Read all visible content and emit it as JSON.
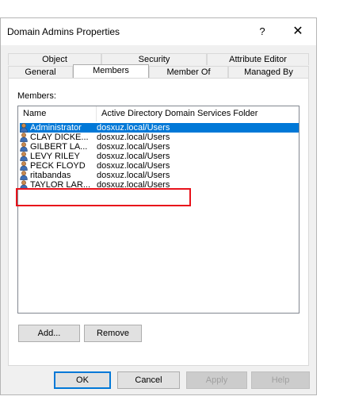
{
  "dialog": {
    "title": "Domain Admins Properties",
    "help_glyph": "?",
    "close_glyph": "✕"
  },
  "tabs": {
    "row1": [
      "Object",
      "Security",
      "Attribute Editor"
    ],
    "row2": [
      "General",
      "Members",
      "Member Of",
      "Managed By"
    ],
    "active": "Members"
  },
  "members": {
    "label": "Members:",
    "columns": [
      "Name",
      "Active Directory Domain Services Folder"
    ],
    "rows": [
      {
        "name": "Administrator",
        "folder": "dosxuz.local/Users",
        "selected": true
      },
      {
        "name": "CLAY DICKE...",
        "folder": "dosxuz.local/Users",
        "selected": false
      },
      {
        "name": "GILBERT LA...",
        "folder": "dosxuz.local/Users",
        "selected": false
      },
      {
        "name": "LEVY RILEY",
        "folder": "dosxuz.local/Users",
        "selected": false
      },
      {
        "name": "PECK FLOYD",
        "folder": "dosxuz.local/Users",
        "selected": false
      },
      {
        "name": "ritabandas",
        "folder": "dosxuz.local/Users",
        "selected": false
      },
      {
        "name": "TAYLOR LAR...",
        "folder": "dosxuz.local/Users",
        "selected": false
      }
    ]
  },
  "buttons": {
    "add": "Add...",
    "remove": "Remove",
    "ok": "OK",
    "cancel": "Cancel",
    "apply": "Apply",
    "help": "Help"
  },
  "colors": {
    "selection": "#0078d7",
    "highlight_box": "#e8121b"
  }
}
